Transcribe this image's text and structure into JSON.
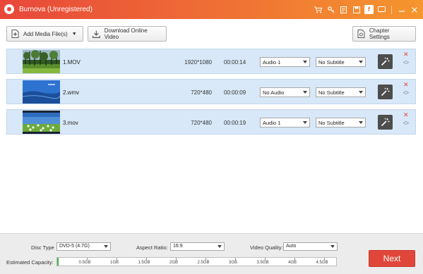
{
  "window": {
    "title": "Burnova (Unregistered)",
    "icons": [
      "cart-icon",
      "key-icon",
      "register-icon",
      "save-icon",
      "facebook-icon",
      "chat-icon",
      "minimize-icon",
      "close-icon"
    ]
  },
  "toolbar": {
    "add_media_label": "Add Media File(s)",
    "download_label": "Download Online Video",
    "chapter_label": "Chapter Settings"
  },
  "files": [
    {
      "name": "1.MOV",
      "resolution": "1920*1080",
      "duration": "00:00:14",
      "audio": "Audio 1",
      "subtitle": "No Subtitle"
    },
    {
      "name": "2.wmv",
      "resolution": "720*480",
      "duration": "00:00:09",
      "audio": "No Audio",
      "subtitle": "No Subtitle"
    },
    {
      "name": "3.mov",
      "resolution": "720*480",
      "duration": "00:00:19",
      "audio": "Audio 1",
      "subtitle": "No Subtitle"
    }
  ],
  "settings": {
    "disc_type_label": "Disc Type",
    "disc_type_value": "DVD-5 (4.7G)",
    "aspect_label": "Aspect Ratio:",
    "aspect_value": "16:9",
    "quality_label": "Video Quality:",
    "quality_value": "Auto",
    "capacity_label": "Estimated Capacity:",
    "capacity_fraction": 0.006,
    "capacity_ticks": [
      "0.5GB",
      "1GB",
      "1.5GB",
      "2GB",
      "2.5GB",
      "3GB",
      "3.5GB",
      "4GB",
      "4.5GB"
    ]
  },
  "next_label": "Next",
  "colors": {
    "accent": "#e0463a",
    "row_bg": "#d8e8f8",
    "capacity_fill": "#3db346"
  }
}
